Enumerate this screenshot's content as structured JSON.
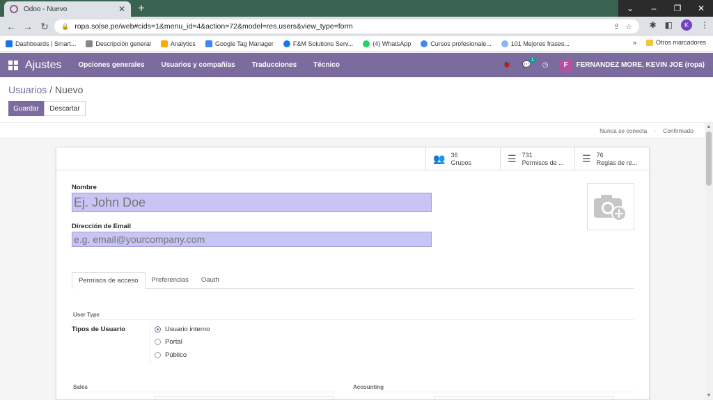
{
  "browser": {
    "tab_title": "Odoo - Nuevo",
    "new_tab_symbol": "+",
    "url": "ropa.solse.pe/web#cids=1&menu_id=4&action=72&model=res.users&view_type=form",
    "profile_initial": "K",
    "window_controls": [
      "⌄",
      "–",
      "❐",
      "✕"
    ]
  },
  "bookmarks": {
    "items": [
      {
        "label": "Dashboards | Smart...",
        "color": "#1a73e8"
      },
      {
        "label": "Descripción general",
        "color": "#888888"
      },
      {
        "label": "Analytics",
        "color": "#f9ab00"
      },
      {
        "label": "Google Tag Manager",
        "color": "#4285f4"
      },
      {
        "label": "F&M Solutions Serv...",
        "color": "#1877f2"
      },
      {
        "label": "(4) WhatsApp",
        "color": "#25d366"
      },
      {
        "label": "Cursos profesionale...",
        "color": "#4285f4"
      },
      {
        "label": "101 Mejores frases...",
        "color": "#8ab4f8"
      }
    ],
    "more": "»",
    "other": "Otros marcadores"
  },
  "navbar": {
    "brand": "Ajustes",
    "menu": [
      "Opciones generales",
      "Usuarios y compañías",
      "Traducciones",
      "Técnico"
    ],
    "chat_count": "1",
    "user_initial": "F",
    "user_name": "FERNANDEZ MORE, KEVIN JOE (ropa)"
  },
  "control": {
    "breadcrumb_parent": "Usuarios",
    "breadcrumb_sep": " / ",
    "breadcrumb_current": "Nuevo",
    "save_label": "Guardar",
    "discard_label": "Descartar"
  },
  "statusbar": {
    "steps": [
      "Nunca se conecta",
      "Confirmado"
    ]
  },
  "smart_buttons": [
    {
      "count": "36",
      "label": "Grupos",
      "icon": "users-icon"
    },
    {
      "count": "731",
      "label": "Permisos de ...",
      "icon": "list-icon"
    },
    {
      "count": "76",
      "label": "Reglas de re...",
      "icon": "list-icon"
    }
  ],
  "form": {
    "name_label": "Nombre",
    "name_placeholder": "Ej. John Doe",
    "email_label": "Dirección de Email",
    "email_placeholder": "e.g. email@yourcompany.com",
    "tabs": [
      "Permisos de acceso",
      "Preferencias",
      "Oauth"
    ],
    "user_type_section": "User Type",
    "user_type_label": "Tipos de Usuario",
    "user_type_options": [
      "Usuario interno",
      "Portal",
      "Público"
    ],
    "sales_section": "Sales",
    "accounting_section": "Accounting"
  }
}
